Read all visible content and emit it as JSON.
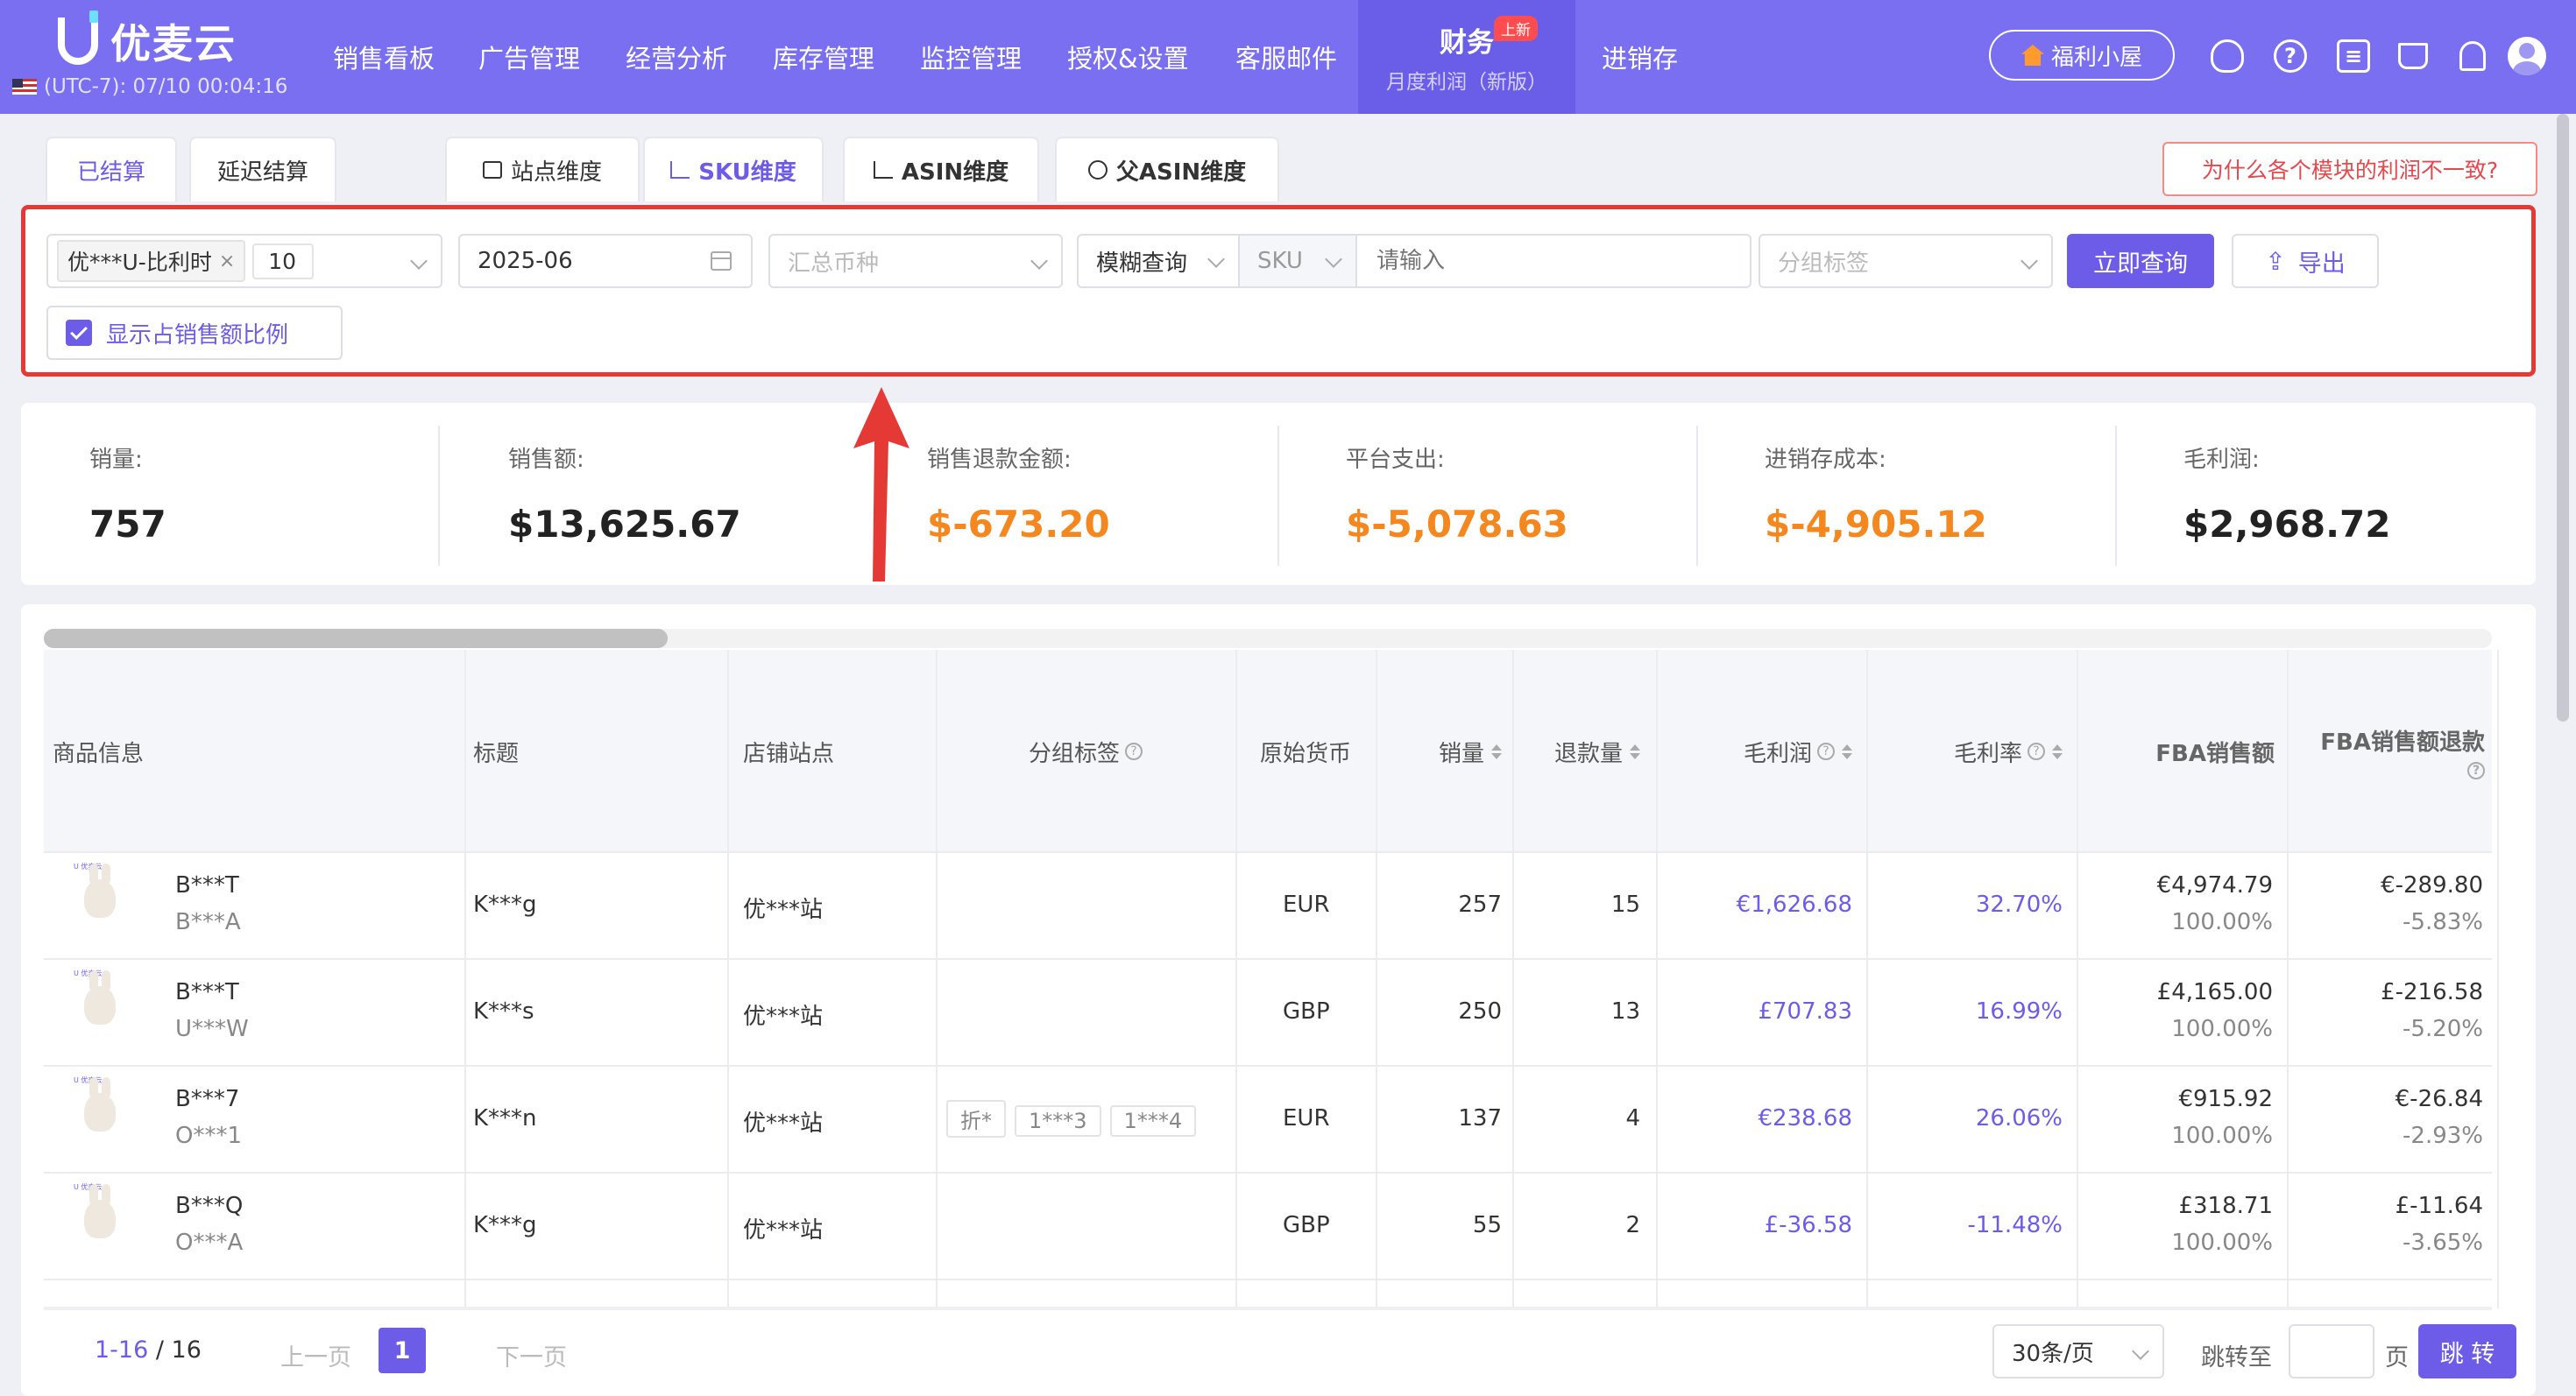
{
  "app": {
    "logo_text": "优麦云",
    "timezone": "(UTC-7): 07/10 00:04:16",
    "nav": [
      "销售看板",
      "广告管理",
      "经营分析",
      "库存管理",
      "监控管理",
      "授权&设置",
      "客服邮件"
    ],
    "nav_active": {
      "title": "财务",
      "subtitle": "月度利润（新版）",
      "badge": "上新"
    },
    "nav_last": "进销存",
    "welfare_label": "福利小屋",
    "header_icons": [
      "user-support-icon",
      "help-icon",
      "message-icon",
      "cart-icon",
      "bell-icon",
      "avatar"
    ]
  },
  "tabs": {
    "settled": "已结算",
    "delayed": "延迟结算",
    "dims": [
      "站点维度",
      "SKU维度",
      "ASIN维度",
      "父ASIN维度"
    ],
    "active_dim": "SKU维度",
    "why_button": "为什么各个模块的利润不一致?"
  },
  "filter": {
    "shop_tag": "优***U-比利时",
    "shop_count": "10",
    "month": "2025-06",
    "currency_placeholder": "汇总币种",
    "query_mode": "模糊查询",
    "search_field": "SKU",
    "search_placeholder": "请输入",
    "group_placeholder": "分组标签",
    "query_button": "立即查询",
    "export_button": "导出",
    "show_ratio_label": "显示占销售额比例",
    "show_ratio_checked": true
  },
  "summary": [
    {
      "label": "销量:",
      "value": "757",
      "highlight": false
    },
    {
      "label": "销售额:",
      "value": "$13,625.67",
      "highlight": false
    },
    {
      "label": "销售退款金额:",
      "value": "$-673.20",
      "highlight": true
    },
    {
      "label": "平台支出:",
      "value": "$-5,078.63",
      "highlight": true
    },
    {
      "label": "进销存成本:",
      "value": "$-4,905.12",
      "highlight": true
    },
    {
      "label": "毛利润:",
      "value": "$2,968.72",
      "highlight": false
    }
  ],
  "table": {
    "headers": {
      "product": "商品信息",
      "title": "标题",
      "shop": "店铺站点",
      "group": "分组标签",
      "currency": "原始货币",
      "qty": "销量",
      "refund_qty": "退款量",
      "gross_profit": "毛利润",
      "gross_margin": "毛利率",
      "fba_sales": "FBA销售额",
      "fba_refund": "FBA销售额退款"
    },
    "rows": [
      {
        "sku": "B***T",
        "sub": "B***A",
        "title": "K***g",
        "shop": "优***站",
        "tags": [],
        "currency": "EUR",
        "qty": "257",
        "refund_qty": "15",
        "gross_profit": "€1,626.68",
        "gross_margin": "32.70%",
        "fba_sales": "€4,974.79",
        "fba_sales_pct": "100.00%",
        "fba_refund": "€-289.80",
        "fba_refund_pct": "-5.83%"
      },
      {
        "sku": "B***T",
        "sub": "U***W",
        "title": "K***s",
        "shop": "优***站",
        "tags": [],
        "currency": "GBP",
        "qty": "250",
        "refund_qty": "13",
        "gross_profit": "£707.83",
        "gross_margin": "16.99%",
        "fba_sales": "£4,165.00",
        "fba_sales_pct": "100.00%",
        "fba_refund": "£-216.58",
        "fba_refund_pct": "-5.20%"
      },
      {
        "sku": "B***7",
        "sub": "O***1",
        "title": "K***n",
        "shop": "优***站",
        "tags": [
          "折*",
          "1***3",
          "1***4"
        ],
        "currency": "EUR",
        "qty": "137",
        "refund_qty": "4",
        "gross_profit": "€238.68",
        "gross_margin": "26.06%",
        "fba_sales": "€915.92",
        "fba_sales_pct": "100.00%",
        "fba_refund": "€-26.84",
        "fba_refund_pct": "-2.93%"
      },
      {
        "sku": "B***Q",
        "sub": "O***A",
        "title": "K***g",
        "shop": "优***站",
        "tags": [],
        "currency": "GBP",
        "qty": "55",
        "refund_qty": "2",
        "gross_profit": "£-36.58",
        "gross_margin": "-11.48%",
        "fba_sales": "£318.71",
        "fba_sales_pct": "100.00%",
        "fba_refund": "£-11.64",
        "fba_refund_pct": "-3.65%"
      }
    ]
  },
  "pagination": {
    "range": "1-16",
    "total": "/ 16",
    "prev": "上一页",
    "current": "1",
    "next": "下一页",
    "page_size": "30条/页",
    "jump_label": "跳转至",
    "page_unit": "页",
    "jump_button": "跳 转"
  },
  "colors": {
    "brand": "#7a6ff0",
    "accent": "#6c5ce7",
    "warn": "#f5871f",
    "alert": "#e53935"
  }
}
